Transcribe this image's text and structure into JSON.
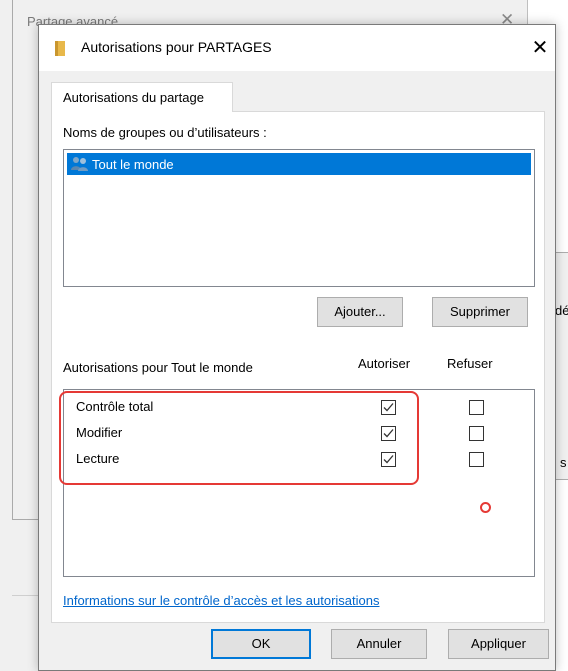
{
  "background_window": {
    "title": "Partage avancé",
    "close_glyph": "✕",
    "edge_text_1": "dé",
    "edge_text_2": "s"
  },
  "dialog": {
    "title": "Autorisations pour PARTAGES",
    "close_glyph": "✕",
    "title_icon": "folder-icon",
    "tab_label": "Autorisations du partage",
    "groups_label": "Noms de groupes ou d’utilisateurs :",
    "groups": [
      {
        "name": "Tout le monde",
        "icon": "users-icon",
        "selected": true
      }
    ],
    "add_button": "Ajouter...",
    "remove_button": "Supprimer",
    "permissions_label": "Autorisations pour Tout le monde",
    "allow_header": "Autoriser",
    "deny_header": "Refuser",
    "permissions": [
      {
        "name": "Contrôle total",
        "allow": true,
        "deny": false
      },
      {
        "name": "Modifier",
        "allow": true,
        "deny": false
      },
      {
        "name": "Lecture",
        "allow": true,
        "deny": false
      }
    ],
    "info_link": "Informations sur le contrôle d’accès et les autorisations",
    "ok_button": "OK",
    "cancel_button": "Annuler",
    "apply_button": "Appliquer"
  },
  "colors": {
    "selection": "#0078d7",
    "annotation": "#e53935",
    "link": "#0066cc"
  }
}
